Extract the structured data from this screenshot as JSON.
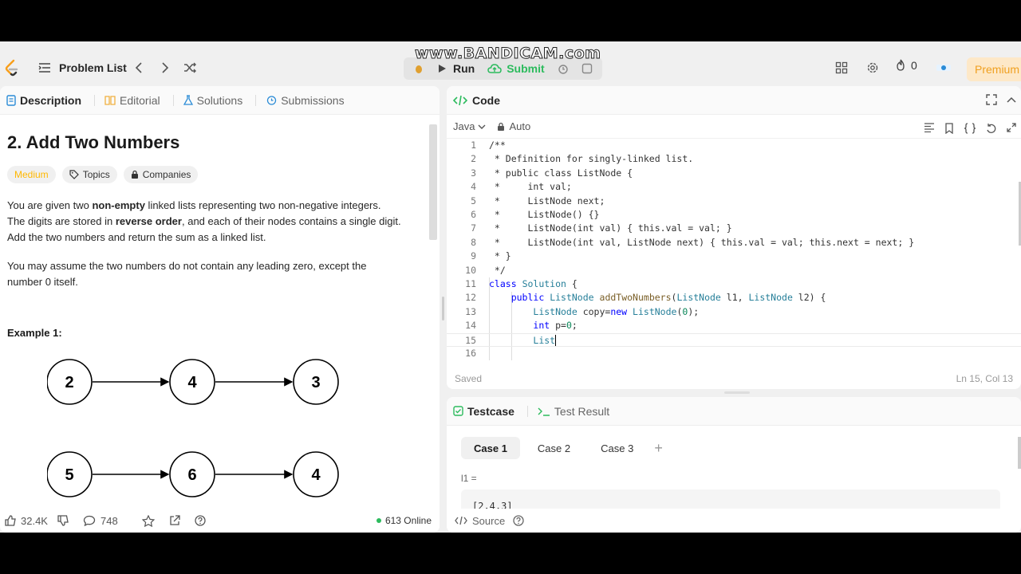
{
  "watermark": "www.BANDICAM.com",
  "topbar": {
    "problem_list": "Problem List",
    "run": "Run",
    "submit": "Submit",
    "streak": "0",
    "premium": "Premium",
    "colors": {
      "submit": "#2cbb5d",
      "premium_text": "#f0a020",
      "premium_bg": "#fde8c8"
    }
  },
  "left_tabs": [
    {
      "label": "Description",
      "icon": "description-icon",
      "active": true
    },
    {
      "label": "Editorial",
      "icon": "book-icon",
      "active": false
    },
    {
      "label": "Solutions",
      "icon": "flask-icon",
      "active": false
    },
    {
      "label": "Submissions",
      "icon": "history-icon",
      "active": false
    }
  ],
  "problem": {
    "title": "2. Add Two Numbers",
    "difficulty": "Medium",
    "topics": "Topics",
    "companies": "Companies",
    "p1_a": "You are given two ",
    "p1_b": "non-empty",
    "p1_c": " linked lists representing two non-negative integers.",
    "p1_d": "The digits are stored in ",
    "p1_e": "reverse order",
    "p1_f": ", and each of their nodes contains a single digit.",
    "p1_g": "Add the two numbers and return the sum as a linked list.",
    "p2": "You may assume the two numbers do not contain any leading zero, except the number 0 itself.",
    "example_label": "Example 1:",
    "list1": [
      "2",
      "4",
      "3"
    ],
    "list2": [
      "5",
      "6",
      "4"
    ]
  },
  "footer": {
    "likes": "32.4K",
    "comments": "748",
    "online": "613 Online"
  },
  "code": {
    "title": "Code",
    "language": "Java",
    "mode": "Auto",
    "saved": "Saved",
    "position": "Ln 15, Col 13",
    "line_numbers": [
      "1",
      "2",
      "3",
      "4",
      "5",
      "6",
      "7",
      "8",
      "9",
      "10",
      "11",
      "12",
      "13",
      "14",
      "15",
      "16"
    ]
  },
  "test": {
    "tab_testcase": "Testcase",
    "tab_result": "Test Result",
    "cases": [
      "Case 1",
      "Case 2",
      "Case 3"
    ],
    "plus": "+",
    "l1_label": "l1 =",
    "l1_value": "[2,4,3]",
    "source": "Source"
  }
}
